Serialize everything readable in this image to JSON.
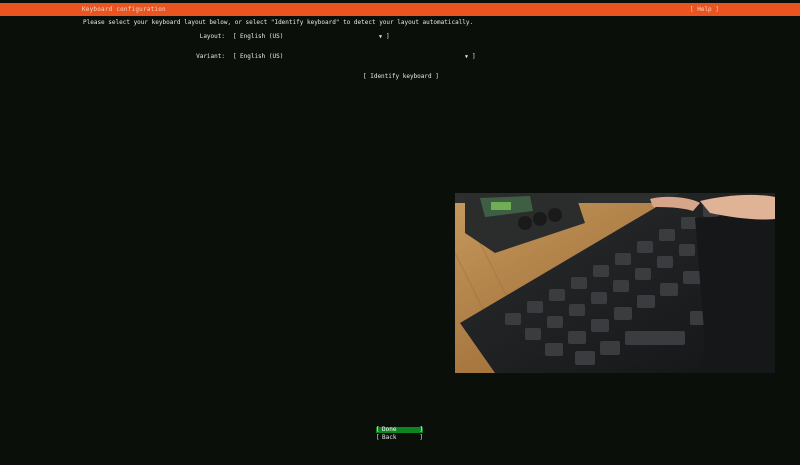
{
  "header": {
    "title": "Keyboard configuration",
    "help_label": "[ Help ]"
  },
  "instructions": "Please select your keyboard layout below, or select \"Identify keyboard\" to detect your layout automatically.",
  "form": {
    "layout_label": "Layout:",
    "layout_value": "English (US)",
    "variant_label": "Variant:",
    "variant_value": "English (US)",
    "identify_label": "[ Identify keyboard ]"
  },
  "footer": {
    "done_label": "Done",
    "back_label": "Back"
  },
  "icons": {
    "dropdown": "triangle-down-icon"
  },
  "colors": {
    "header": "#e95420",
    "background": "#0b0f0a",
    "done_button": "#0e8420"
  }
}
